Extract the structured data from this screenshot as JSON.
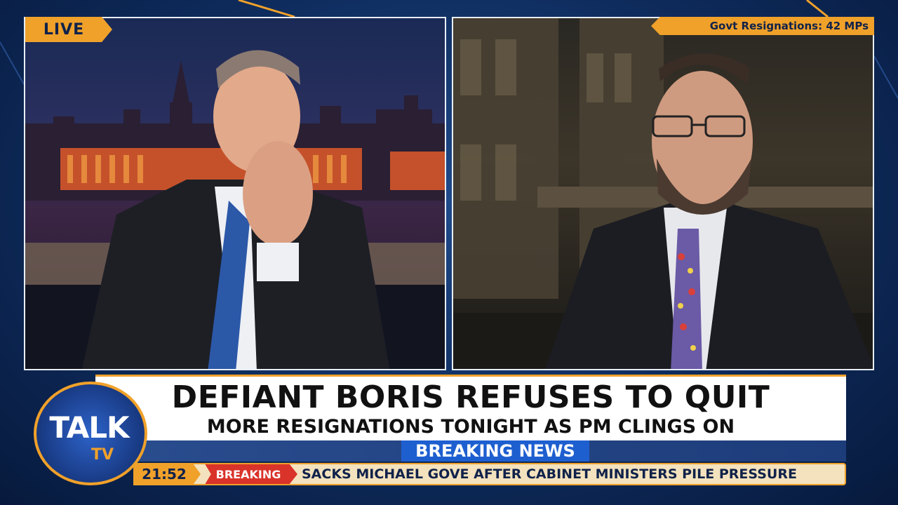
{
  "live_tag": "LIVE",
  "resignations_tag": "Govt Resignations: 42 MPs",
  "headline": "DEFIANT BORIS REFUSES TO QUIT",
  "subheadline": "MORE RESIGNATIONS TONIGHT AS PM CLINGS ON",
  "breaking_news_label": "BREAKING NEWS",
  "ticker": {
    "time": "21:52",
    "chip": "BREAKING",
    "text": "SACKS MICHAEL GOVE AFTER CABINET MINISTERS PILE PRESSURE"
  },
  "logo": {
    "main": "TALK",
    "sub": "TV"
  },
  "colors": {
    "accent": "#f0a12a",
    "navy": "#10224a",
    "breaking_red": "#d9332a",
    "breaking_blue": "#1e5fd0"
  }
}
